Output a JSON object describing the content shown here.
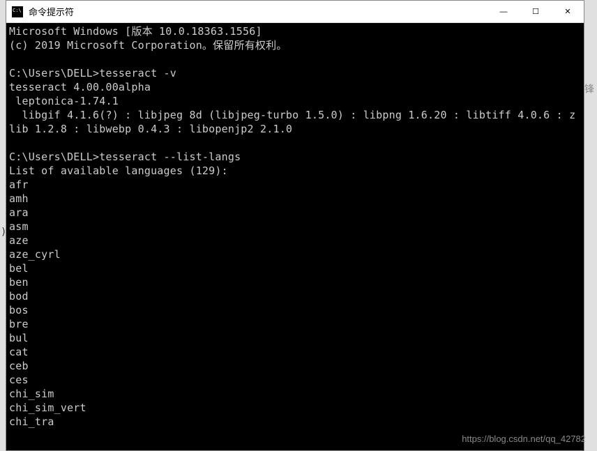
{
  "window": {
    "title": "命令提示符",
    "buttons": {
      "minimize": "—",
      "maximize": "☐",
      "close": "✕"
    }
  },
  "terminal": {
    "header_line1": "Microsoft Windows [版本 10.0.18363.1556]",
    "header_line2": "(c) 2019 Microsoft Corporation。保留所有权利。",
    "prompt1": "C:\\Users\\DELL>tesseract -v",
    "version_line": "tesseract 4.00.00alpha",
    "leptonica_line": " leptonica-1.74.1",
    "libs_line": "  libgif 4.1.6(?) : libjpeg 8d (libjpeg-turbo 1.5.0) : libpng 1.6.20 : libtiff 4.0.6 : zlib 1.2.8 : libwebp 0.4.3 : libopenjp2 2.1.0",
    "prompt2": "C:\\Users\\DELL>tesseract --list-langs",
    "list_header": "List of available languages (129):",
    "languages": [
      "afr",
      "amh",
      "ara",
      "asm",
      "aze",
      "aze_cyrl",
      "bel",
      "ben",
      "bod",
      "bos",
      "bre",
      "bul",
      "cat",
      "ceb",
      "ces",
      "chi_sim",
      "chi_sim_vert",
      "chi_tra"
    ]
  },
  "watermark": "https://blog.csdn.net/qq_42782",
  "bg_edge": "锋",
  "bg_bracket": ")"
}
